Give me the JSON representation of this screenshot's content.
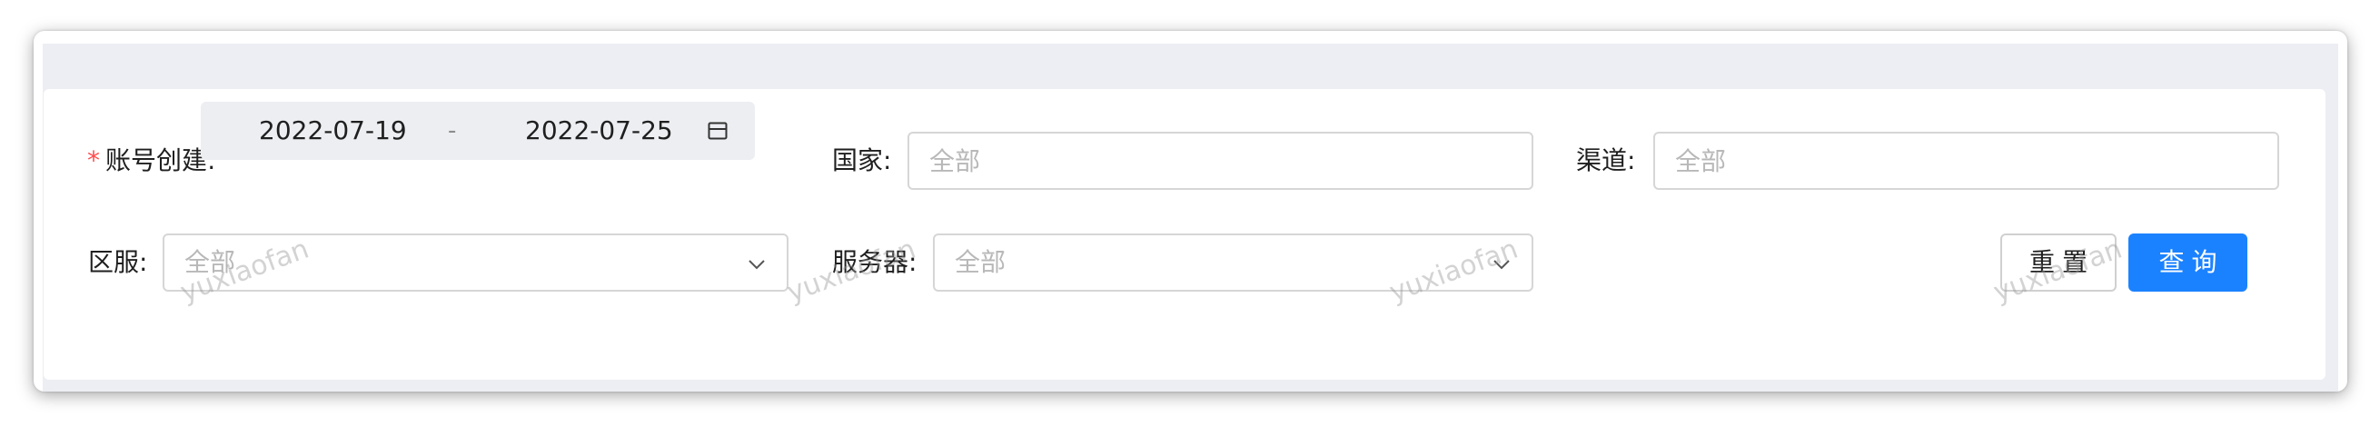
{
  "filters": {
    "account_created": {
      "required_mark": "*",
      "label": "账号创建:",
      "start": "2022-07-19",
      "separator": "-",
      "end": "2022-07-25"
    },
    "country": {
      "label": "国家:",
      "placeholder": "全部"
    },
    "channel": {
      "label": "渠道:",
      "placeholder": "全部"
    },
    "region": {
      "label": "区服:",
      "placeholder": "全部"
    },
    "server": {
      "label": "服务器:",
      "placeholder": "全部"
    }
  },
  "actions": {
    "reset_label": "重置",
    "query_label": "查询"
  },
  "watermark": "yuxiaofan",
  "colors": {
    "primary": "#1b82ff",
    "required": "#ff4d4f",
    "page_background": "#eceef3",
    "placeholder": "#b8b8b8"
  },
  "icons": {
    "date_picker": "calendar-icon",
    "select_arrow": "chevron-down-icon"
  }
}
